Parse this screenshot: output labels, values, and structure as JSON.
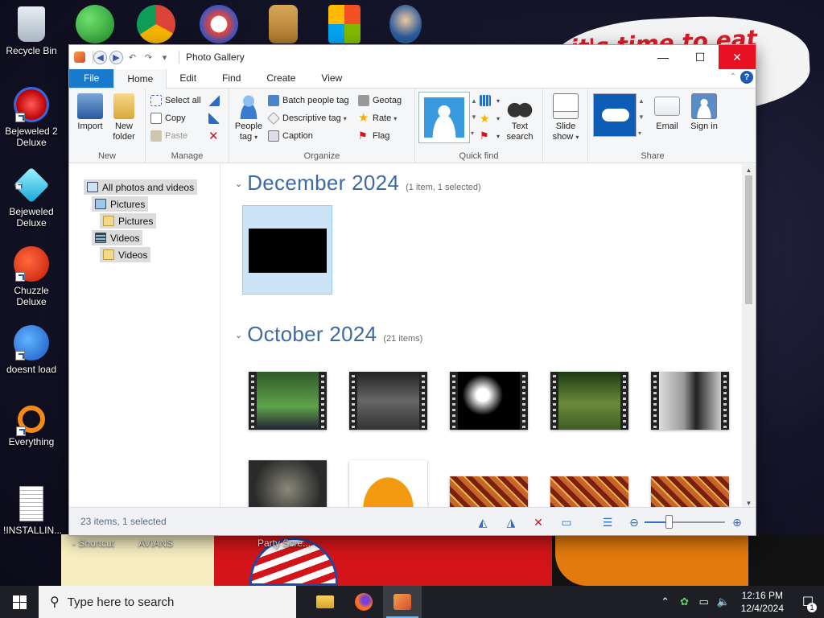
{
  "desktop": {
    "icons": [
      {
        "name": "recycle-bin",
        "label": "Recycle Bin"
      },
      {
        "name": "bejeweled-2",
        "label": "Bejeweled 2 Deluxe"
      },
      {
        "name": "bejeweled",
        "label": "Bejeweled Deluxe"
      },
      {
        "name": "chuzzle",
        "label": "Chuzzle Deluxe"
      },
      {
        "name": "thunderbird",
        "label": "doesnt load"
      },
      {
        "name": "everything",
        "label": "Everything"
      },
      {
        "name": "installing",
        "label": "!INSTALLIN..."
      }
    ],
    "wallpaper_text": "it's time to eat shit",
    "bottom_labels": [
      "- Shortcut",
      "AVIANS",
      "Party Scre..."
    ]
  },
  "window": {
    "title": "Photo Gallery",
    "tabs": [
      "File",
      "Home",
      "Edit",
      "Find",
      "Create",
      "View"
    ],
    "ribbon": {
      "new": {
        "label": "New",
        "import": "Import",
        "new_folder": "New folder"
      },
      "manage": {
        "label": "Manage",
        "select_all": "Select all",
        "copy": "Copy",
        "paste": "Paste"
      },
      "organize": {
        "label": "Organize",
        "people_tag": "People tag",
        "batch_people_tag": "Batch people tag",
        "descriptive_tag": "Descriptive tag",
        "caption": "Caption",
        "geotag": "Geotag",
        "rate": "Rate",
        "flag": "Flag"
      },
      "quick_find": {
        "label": "Quick find",
        "text_search": "Text search"
      },
      "slideshow": {
        "label": "Slide show"
      },
      "share": {
        "label": "Share",
        "email": "Email",
        "sign_in": "Sign in"
      }
    },
    "nav": [
      {
        "label": "All photos and videos",
        "level": 0
      },
      {
        "label": "Pictures",
        "level": 1
      },
      {
        "label": "Pictures",
        "level": 2
      },
      {
        "label": "Videos",
        "level": 1
      },
      {
        "label": "Videos",
        "level": 2
      }
    ],
    "sections": [
      {
        "title": "December 2024",
        "count": "(1 item, 1 selected)"
      },
      {
        "title": "October 2024",
        "count": "(21 items)"
      }
    ],
    "status": "23 items, 1 selected",
    "zoom_fraction": 0.3
  },
  "taskbar": {
    "search_placeholder": "Type here to search",
    "time": "12:16 PM",
    "date": "12/4/2024",
    "notification_count": "1"
  },
  "colors": {
    "accent": "#1979ca",
    "title_blue": "#3b6aa6",
    "close_red": "#e81123"
  }
}
